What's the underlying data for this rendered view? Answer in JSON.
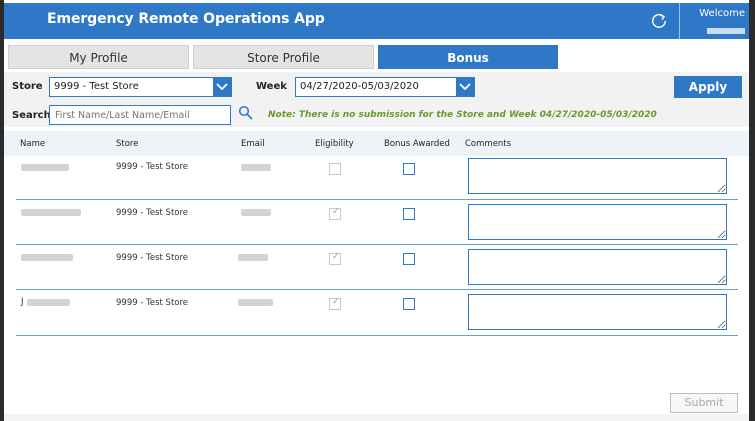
{
  "header": {
    "title": "Emergency Remote Operations App",
    "welcome": "Welcome",
    "refresh_icon": "refresh-icon"
  },
  "tabs": [
    {
      "label": "My Profile",
      "active": false
    },
    {
      "label": "Store Profile",
      "active": false
    },
    {
      "label": "Bonus",
      "active": true
    }
  ],
  "filters": {
    "store_label": "Store",
    "store_value": "9999 - Test Store",
    "week_label": "Week",
    "week_value": "04/27/2020-05/03/2020",
    "apply_label": "Apply",
    "search_label": "Search",
    "search_placeholder": "First Name/Last Name/Email",
    "note": "Note: There is no submission for the Store and Week 04/27/2020-05/03/2020"
  },
  "table": {
    "columns": [
      "Name",
      "Store",
      "Email",
      "Eligibility",
      "Bonus Awarded",
      "Comments"
    ],
    "rows": [
      {
        "name_prefix": "",
        "store": "9999 - Test Store",
        "eligible": false,
        "bonus_awarded": false,
        "comment": ""
      },
      {
        "name_prefix": "",
        "store": "9999 - Test Store",
        "eligible": true,
        "bonus_awarded": false,
        "comment": ""
      },
      {
        "name_prefix": "",
        "store": "9999 - Test Store",
        "eligible": true,
        "bonus_awarded": false,
        "comment": ""
      },
      {
        "name_prefix": "J",
        "store": "9999 - Test Store",
        "eligible": true,
        "bonus_awarded": false,
        "comment": ""
      }
    ]
  },
  "footer": {
    "submit_label": "Submit",
    "submit_enabled": false
  },
  "colors": {
    "accent": "#2f78c8",
    "note": "#6a9a2e"
  }
}
